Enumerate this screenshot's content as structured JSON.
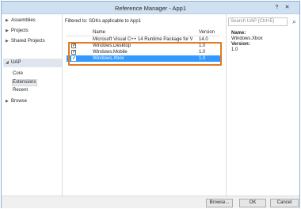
{
  "window": {
    "title": "Reference Manager - App1",
    "help": "?",
    "close": "✕"
  },
  "nav": {
    "items": [
      {
        "label": "Assemblies",
        "arrow": "▶"
      },
      {
        "label": "Projects",
        "arrow": "▶"
      },
      {
        "label": "Shared Projects",
        "arrow": "▶"
      },
      {
        "label": "UAP",
        "arrow": "◢"
      },
      {
        "label": "Browse",
        "arrow": "▶"
      }
    ],
    "sub_items": [
      "Core",
      "Extensions",
      "Recent"
    ],
    "selected": "UAP",
    "selected_sub": "Extensions"
  },
  "filter": {
    "text": "Filtered to: SDKs applicable to App1"
  },
  "table": {
    "columns": [
      "Name",
      "Version"
    ],
    "rows": [
      {
        "name": "Microsoft Visual C++ 14 Runtime Package for Wi...",
        "version": "14.0",
        "checked": false,
        "check": ""
      },
      {
        "name": "Windows.Desktop",
        "version": "1.0",
        "checked": true,
        "check": "✓"
      },
      {
        "name": "Windows.Mobile",
        "version": "1.0",
        "checked": true,
        "check": "✓"
      },
      {
        "name": "Windows.Xbox",
        "version": "1.0",
        "checked": true,
        "check": "✓",
        "selected": true
      }
    ]
  },
  "search": {
    "placeholder": "Search UAP (Ctrl+E)",
    "icon": "search-icon",
    "glyph": "⌕"
  },
  "details": {
    "name_label": "Name:",
    "name_value": "Windows.Xbox",
    "version_label": "Version:",
    "version_value": "1.0"
  },
  "buttons": {
    "browse": "Browse...",
    "ok": "OK",
    "cancel": "Cancel"
  },
  "colors": {
    "title_bar": "#cfe0f1",
    "selection": "#3399ff",
    "highlight_box": "#e07b1f"
  }
}
